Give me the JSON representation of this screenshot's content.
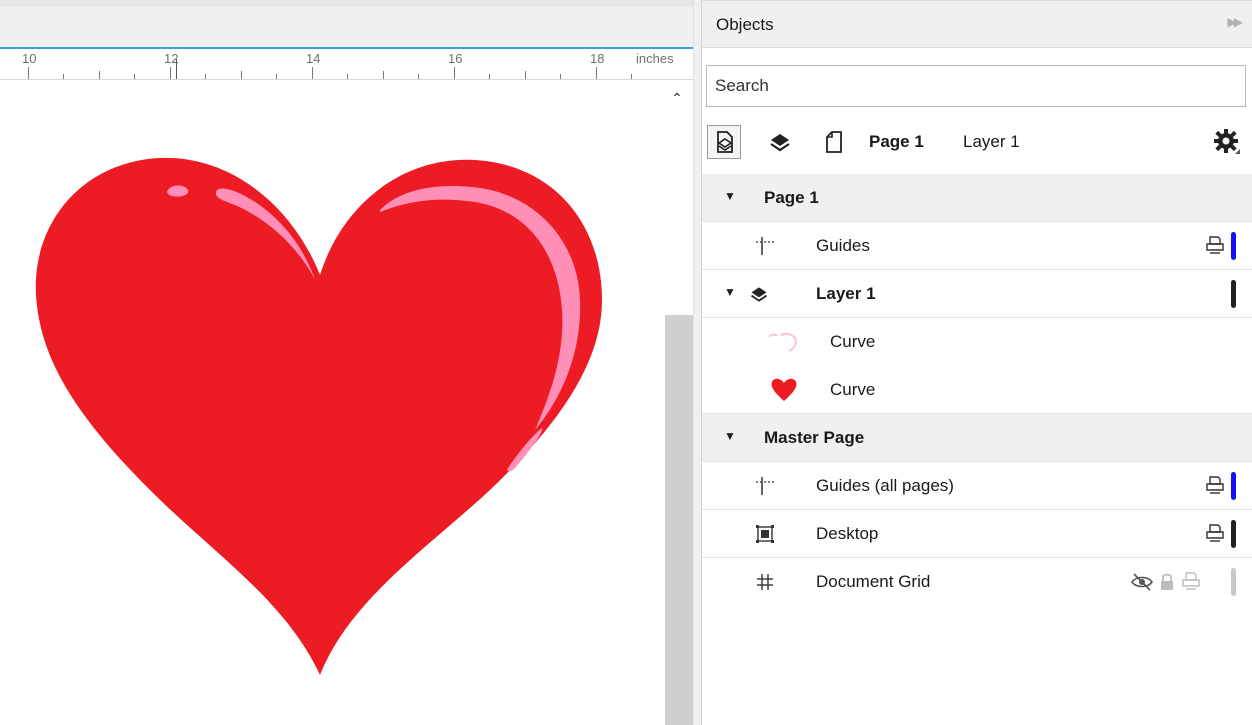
{
  "ruler": {
    "labels": [
      "10",
      "12",
      "14",
      "16",
      "18"
    ],
    "units": "inches"
  },
  "panel": {
    "title": "Objects",
    "search_placeholder": "Search",
    "toolbar": {
      "page_label": "Page 1",
      "layer_label": "Layer 1"
    }
  },
  "tree": {
    "page1": {
      "label": "Page 1"
    },
    "guides": {
      "label": "Guides",
      "color": "#1010ff"
    },
    "layer1": {
      "label": "Layer 1",
      "color": "#222222"
    },
    "curve1": {
      "label": "Curve"
    },
    "curve2": {
      "label": "Curve"
    },
    "master_page": {
      "label": "Master Page"
    },
    "guides_all": {
      "label": "Guides (all pages)",
      "color": "#1010ff"
    },
    "desktop": {
      "label": "Desktop",
      "color": "#222222"
    },
    "document_grid": {
      "label": "Document Grid",
      "color": "#c8c8c8"
    }
  },
  "colors": {
    "heart": "#ed1c24",
    "highlight": "#ff8fb6",
    "ruler_accent": "#3ea0e0"
  }
}
